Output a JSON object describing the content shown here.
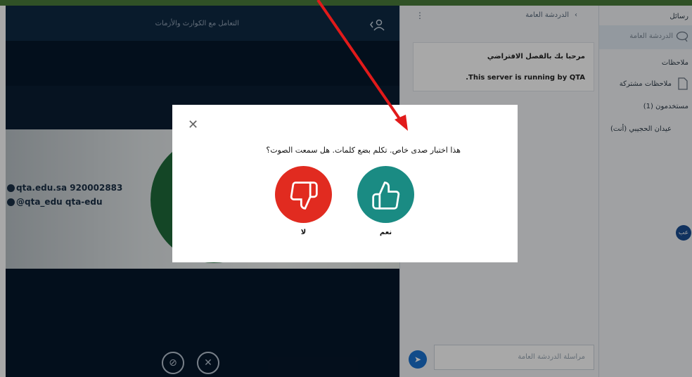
{
  "colors": {
    "top_strip": "#4a7c3a",
    "modal_no": "#e12b20",
    "modal_yes": "#1a8b83",
    "annotation_arrow": "#e11a1a"
  },
  "main": {
    "title": "التعامل مع الكوارث والأزمات"
  },
  "slide": {
    "contact_line1": "qta.edu.sa  920002883",
    "contact_line2": "@qta_edu  qta-edu"
  },
  "chat": {
    "title": "الدردشة العامة",
    "welcome": {
      "line1": "مرحبا بك بالفصل الافتراضي",
      "line2": ".This server is running by QTA"
    },
    "placeholder": "مراسلة الدردشة العامة"
  },
  "sidebar": {
    "messages_header": "رسائل",
    "public_chat": "الدردشة العامة",
    "notes_header": "ملاحظات",
    "shared_notes": "ملاحظات مشتركة",
    "users_header": "مستخدمون (1)",
    "user": {
      "initials": "عب",
      "name": "عيدان الحجيبي (أنت)"
    }
  },
  "modal": {
    "question": "هذا اختبار صدى خاص. تكلم بضع كلمات. هل سمعت الصوت؟",
    "no_label": "لا",
    "yes_label": "نعم"
  }
}
